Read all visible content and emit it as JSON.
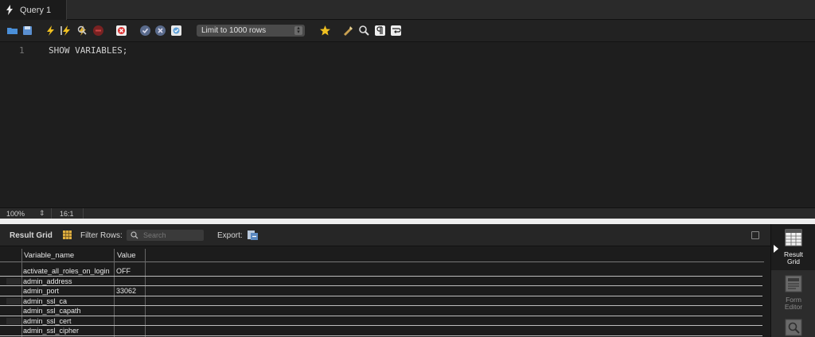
{
  "tabs": [
    {
      "label": "Query 1"
    }
  ],
  "toolbar": {
    "limit_select": "Limit to 1000 rows",
    "icons": [
      "open-folder-icon",
      "save-icon",
      "execute-icon",
      "execute-current-icon",
      "explain-icon",
      "stop-icon",
      "toggle-error-icon",
      "commit-icon",
      "rollback-icon",
      "autocommit-icon",
      "favorite-snippet-icon",
      "beautify-icon",
      "find-icon",
      "invisible-chars-icon",
      "wrap-lines-icon"
    ]
  },
  "editor": {
    "lines": [
      {
        "number": "1",
        "text": "SHOW VARIABLES;"
      }
    ]
  },
  "statusbar": {
    "zoom": "100%",
    "cursor": "16:1"
  },
  "result": {
    "label": "Result Grid",
    "filter_label": "Filter Rows:",
    "search_placeholder": "Search",
    "export_label": "Export:",
    "columns": [
      "Variable_name",
      "Value"
    ],
    "rows": [
      {
        "name": "activate_all_roles_on_login",
        "value": "OFF"
      },
      {
        "name": "admin_address",
        "value": ""
      },
      {
        "name": "admin_port",
        "value": "33062"
      },
      {
        "name": "admin_ssl_ca",
        "value": ""
      },
      {
        "name": "admin_ssl_capath",
        "value": ""
      },
      {
        "name": "admin_ssl_cert",
        "value": ""
      },
      {
        "name": "admin_ssl_cipher",
        "value": ""
      }
    ]
  },
  "sidepanel": {
    "result_grid_line1": "Result",
    "result_grid_line2": "Grid",
    "form_editor_line1": "Form",
    "form_editor_line2": "Editor"
  }
}
